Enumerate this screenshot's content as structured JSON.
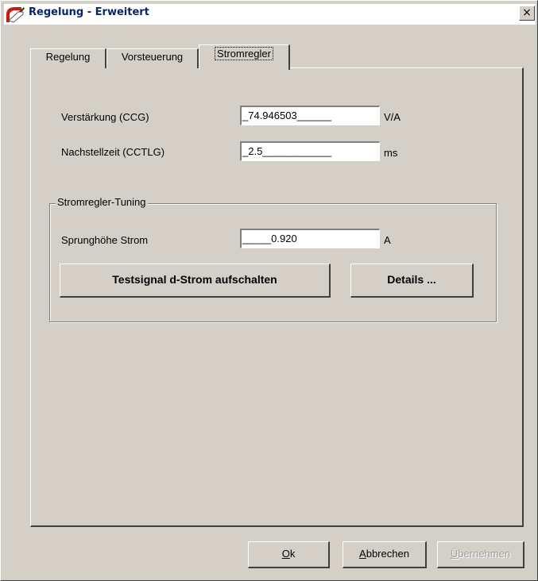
{
  "window": {
    "title": "Regelung - Erweitert",
    "close_glyph": "×"
  },
  "tabs": [
    {
      "label": "Regelung"
    },
    {
      "label": "Vorsteuerung"
    },
    {
      "label": "Stromregler"
    }
  ],
  "fields": {
    "gain": {
      "label": "Verstärkung (CCG)",
      "value": "_74.946503______",
      "unit": "V/A"
    },
    "reset_time": {
      "label": "Nachstellzeit (CCTLG)",
      "value": "_2.5____________",
      "unit": "ms"
    }
  },
  "tuning": {
    "title": "Stromregler-Tuning",
    "step_label": "Sprunghöhe Strom",
    "step_value": "_____0.920",
    "step_unit": "A",
    "test_button": "Testsignal d-Strom aufschalten",
    "details_button": "Details ..."
  },
  "footer": {
    "ok_mnemonic": "O",
    "ok_rest": "k",
    "cancel_mnemonic": "A",
    "cancel_rest": "bbrechen",
    "apply_mnemonic": "Ü",
    "apply_rest": "bernehmen"
  },
  "colors": {
    "title_text": "#0a246a",
    "face": "#d4d0c8"
  }
}
